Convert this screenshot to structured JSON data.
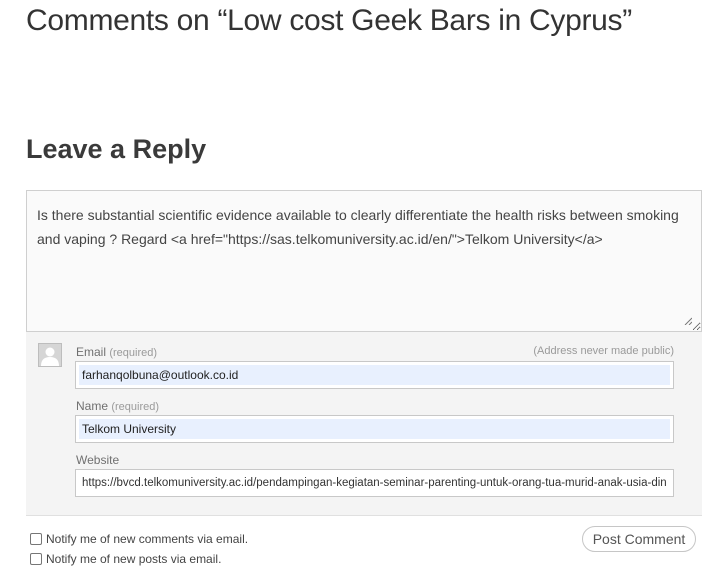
{
  "comments_heading": "Comments on “Low cost Geek Bars in Cyprus”",
  "reply_heading": "Leave a Reply",
  "comment": {
    "text": "Is there substantial scientific evidence available to clearly differentiate the health risks between smoking and vaping ? Regard <a href=\"https://sas.telkomuniversity.ac.id/en/\">Telkom University</a>"
  },
  "form": {
    "avatar_icon": "default-avatar-icon",
    "required_text": "(required)",
    "email": {
      "label": "Email",
      "hint": "(Address never made public)",
      "value": "farhanqolbuna@outlook.co.id"
    },
    "name": {
      "label": "Name",
      "value": "Telkom University"
    },
    "website": {
      "label": "Website",
      "value": "https://bvcd.telkomuniversity.ac.id/pendampingan-kegiatan-seminar-parenting-untuk-orang-tua-murid-anak-usia-dini/"
    }
  },
  "notify": {
    "comments_label": "Notify me of new comments via email.",
    "posts_label": "Notify me of new posts via email.",
    "comments_checked": false,
    "posts_checked": false
  },
  "submit_label": "Post Comment",
  "colors": {
    "autofill_bg": "#e8f0fe",
    "panel_bg": "#f4f4f4",
    "text": "#333333"
  }
}
